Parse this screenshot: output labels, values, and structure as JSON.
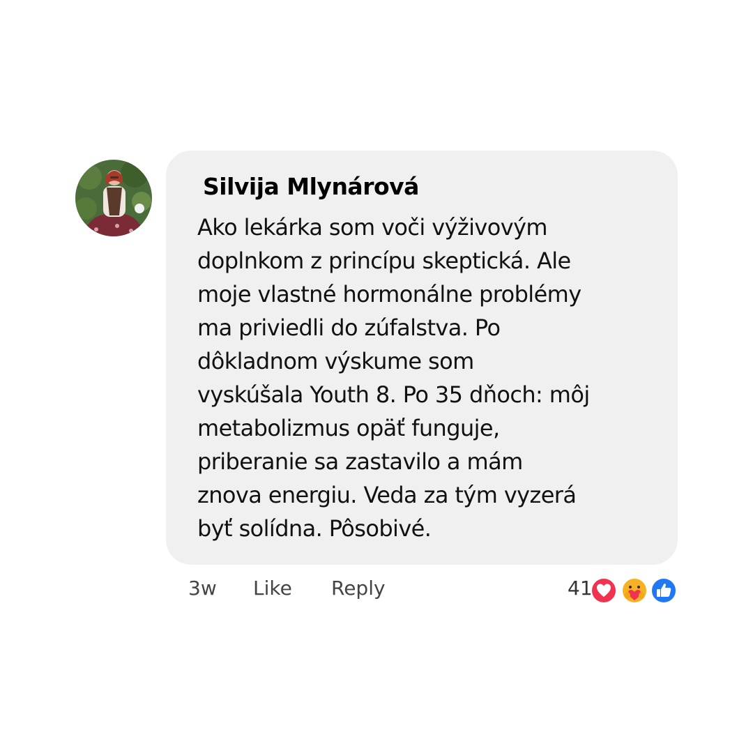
{
  "comment": {
    "author": "Silvija Mlynárová",
    "text_lines": [
      "Ako lekárka som voči výživovým",
      "doplnkom z princípu skeptická. Ale",
      "moje vlastné hormonálne problémy",
      "ma priviedli do zúfalstva. Po",
      "dôkladnom výskume som",
      "vyskúšala Youth 8. Po 35 dňoch: môj",
      "metabolizmus opäť funguje,",
      "priberanie sa zastavilo a mám",
      "znova energiu. Veda za tým vyzerá",
      "byť solídna. Pôsobivé."
    ]
  },
  "actions": {
    "time": "3w",
    "like_label": "Like",
    "reply_label": "Reply"
  },
  "reactions": {
    "count": "41",
    "icons": [
      "love-icon",
      "care-icon",
      "like-icon"
    ],
    "colors": {
      "love": "#f0334f",
      "care": "#f7b125",
      "like": "#2078f4"
    }
  },
  "colors": {
    "bubble": "#f0f0f0",
    "background": "#ffffff"
  }
}
